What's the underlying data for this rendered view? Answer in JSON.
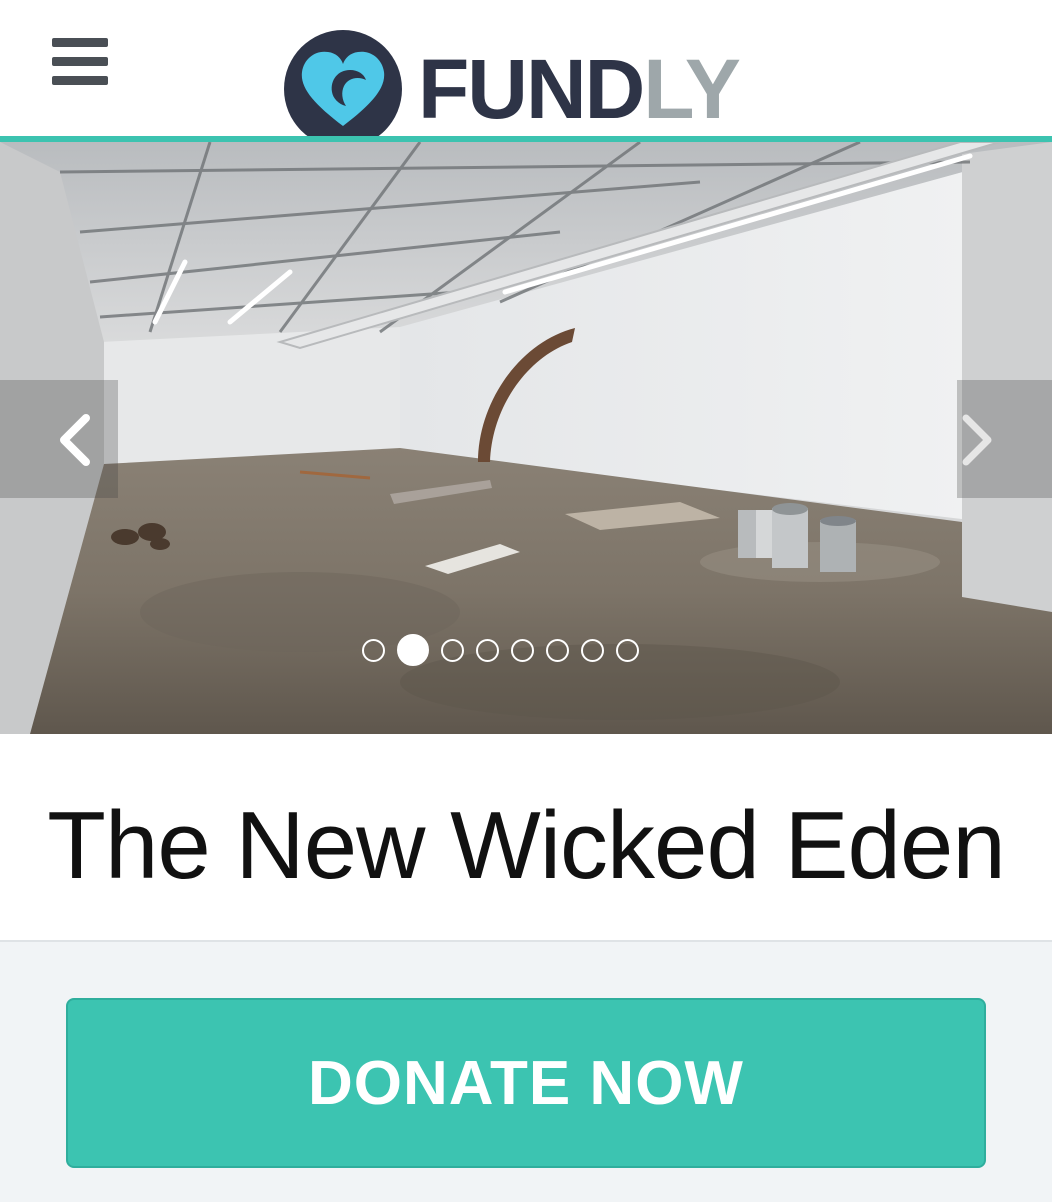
{
  "header": {
    "logo_text_primary": "FUND",
    "logo_text_secondary": "LY",
    "accent_color": "#3cc3b0",
    "brand_dark": "#2e3447",
    "brand_light": "#9ea7aa",
    "menu_icon": "hamburger-menu-icon"
  },
  "carousel": {
    "prev_icon": "chevron-left-icon",
    "next_icon": "chevron-right-icon",
    "slide_count": 8,
    "active_slide": 2
  },
  "campaign": {
    "title": "The New Wicked Eden"
  },
  "donate": {
    "label": "DONATE NOW",
    "color": "#3cc4b1"
  }
}
